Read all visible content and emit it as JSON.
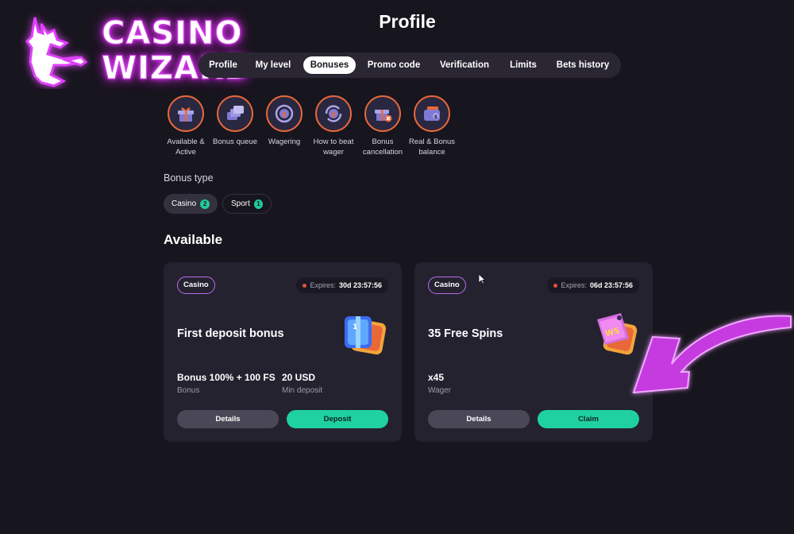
{
  "logo": {
    "line1": "CASINO",
    "line2": "WIZARD"
  },
  "page": {
    "title": "Profile"
  },
  "tabs": [
    {
      "label": "Profile",
      "active": false
    },
    {
      "label": "My level",
      "active": false
    },
    {
      "label": "Bonuses",
      "active": true
    },
    {
      "label": "Promo code",
      "active": false
    },
    {
      "label": "Verification",
      "active": false
    },
    {
      "label": "Limits",
      "active": false
    },
    {
      "label": "Bets history",
      "active": false
    }
  ],
  "categories": [
    {
      "label": "Available & Active",
      "icon": "gift-icon"
    },
    {
      "label": "Bonus queue",
      "icon": "stack-icon"
    },
    {
      "label": "Wagering",
      "icon": "coin-cycle-icon"
    },
    {
      "label": "How to beat wager",
      "icon": "coin-refresh-icon"
    },
    {
      "label": "Bonus cancellation",
      "icon": "gift-cancel-icon"
    },
    {
      "label": "Real & Bonus balance",
      "icon": "wallet-icon"
    }
  ],
  "bonus_type": {
    "label": "Bonus type",
    "chips": [
      {
        "label": "Casino",
        "count": "2"
      },
      {
        "label": "Sport",
        "count": "1"
      }
    ]
  },
  "available": {
    "title": "Available",
    "cards": [
      {
        "tag": "Casino",
        "expires_label": "Expires:",
        "expires_time": "30d 23:57:56",
        "title": "First deposit bonus",
        "stat1_value": "Bonus 100% + 100 FS",
        "stat1_label": "Bonus",
        "stat2_value": "20 USD",
        "stat2_label": "Min deposit",
        "details_label": "Details",
        "action_label": "Deposit"
      },
      {
        "tag": "Casino",
        "expires_label": "Expires:",
        "expires_time": "06d 23:57:56",
        "title": "35 Free Spins",
        "stat1_value": "x45",
        "stat1_label": "Wager",
        "details_label": "Details",
        "action_label": "Claim"
      }
    ]
  },
  "colors": {
    "background": "#17151d",
    "card": "#252230",
    "accent_green": "#1fd1a0",
    "accent_orange": "#e8683a",
    "neon_purple": "#d946ef"
  }
}
